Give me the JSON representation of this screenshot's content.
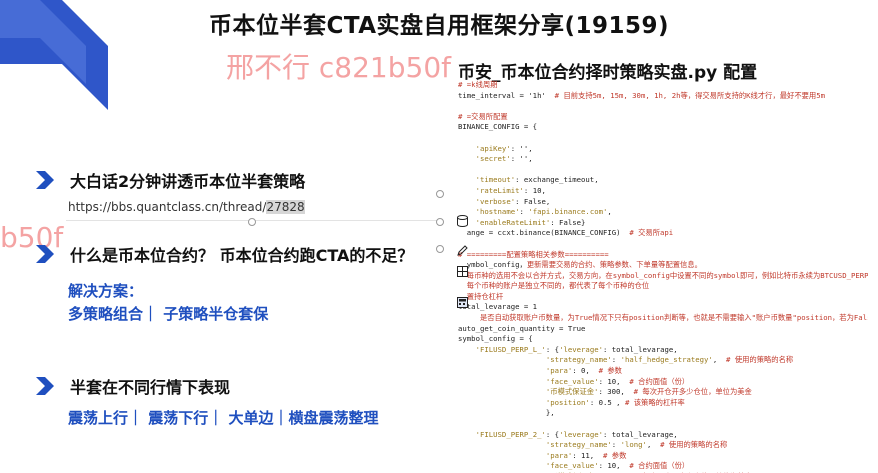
{
  "slide": {
    "title": "币本位半套CTA实盘自用框架分享(19159)",
    "watermark": "邢不行 c821b50f",
    "watermark_fragment": "b50f",
    "accent_color": "#1f4fbf",
    "watermark_color": "#f4a3a3"
  },
  "left": {
    "section1": {
      "title": "大白话2分钟讲透币本位半套策略",
      "url_prefix": "https://bbs.quantclass.cn/thread/",
      "url_highlight": "27828"
    },
    "section2": {
      "title": "什么是币本位合约？ 币本位合约跑CTA的不足？",
      "solution_label": "解决方案：",
      "solution_text": "多策略组合｜ 子策略半仓套保"
    },
    "section3": {
      "title": "半套在不同行情下表现",
      "conditions": "震荡上行｜ 震荡下行｜ 大单边｜横盘震荡整理"
    }
  },
  "code_panel": {
    "title": "币安_币本位合约择时策略实盘.py 配置",
    "icons": [
      "database-icon",
      "pencil-icon",
      "grid-icon",
      "calculator-icon"
    ]
  }
}
